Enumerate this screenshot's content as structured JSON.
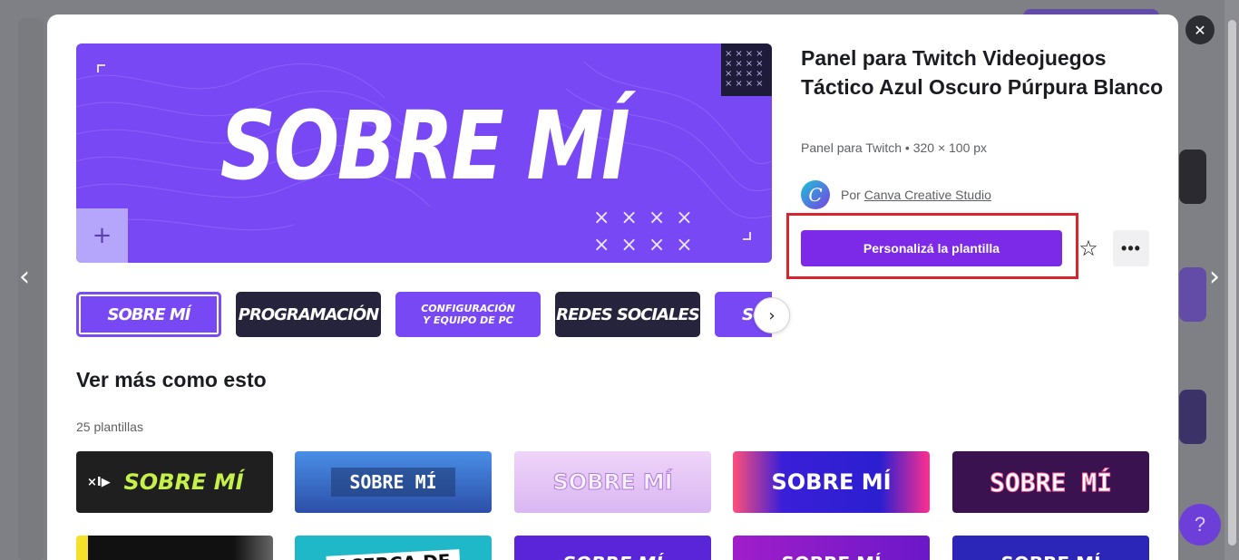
{
  "modal": {
    "title": "Panel para Twitch Videojuegos Táctico Azul Oscuro Púrpura Blanco",
    "subtitle": "Panel para Twitch • 320 × 100 px",
    "author_prefix": "Por",
    "author_name": "Canva Creative Studio",
    "author_logo_letter": "C",
    "cta_label": "Personalizá la plantilla",
    "star_icon": "☆",
    "more_icon": "•••",
    "close_icon": "✕",
    "prev_icon": "‹",
    "next_icon": "›",
    "thumb_next_icon": "›"
  },
  "preview": {
    "title": "SOBRE MÍ",
    "plus_icon": "+",
    "grid_marks": "××××\n××××\n××××\n××××",
    "x_marks": "××××\n××××",
    "bg_color": "#7848f4"
  },
  "thumbnails": [
    {
      "label": "SOBRE MÍ",
      "bg": "#7848f4",
      "selected": true
    },
    {
      "label": "PROGRAMACIÓN",
      "bg": "#26233d"
    },
    {
      "label": "CONFIGURACIÓN Y EQUIPO DE PC",
      "bg": "#7848f4"
    },
    {
      "label": "REDES SOCIALES",
      "bg": "#26233d"
    },
    {
      "label": "SO",
      "bg": "#7848f4"
    }
  ],
  "more_like_this": {
    "title": "Ver más como esto",
    "count": "25 plantillas",
    "cards": [
      {
        "label": "SOBRE MÍ",
        "bg": "#1f1f1f",
        "color": "#c6f04a",
        "brand": "×I▶"
      },
      {
        "label": "SOBRE MÍ",
        "bg": "#3b6fd6",
        "color": "#ffffff"
      },
      {
        "label": "SOBRE MÍ",
        "bg": "#e9c8f7",
        "color": "#f7f2ff"
      },
      {
        "label": "SOBRE MÍ",
        "bg": "#2b1fd0",
        "color": "#ffffff"
      },
      {
        "label": "SOBRE MÍ",
        "bg": "#3a124f",
        "color": "#ffffff"
      },
      {
        "label": "",
        "bg": "#111111",
        "color": "#f5e02a"
      },
      {
        "label": "ACERCA DE",
        "bg": "#1fb8c9",
        "color": "#111111"
      },
      {
        "label": "SOBRE MÍ",
        "bg": "#5a25d8",
        "color": "#ffffff"
      },
      {
        "label": "SOBRE MÍ",
        "bg": "#6a18c9",
        "color": "#ffffff"
      },
      {
        "label": "SOBRE MÍ",
        "bg": "#2c26b8",
        "color": "#ffffff"
      }
    ]
  },
  "colors": {
    "accent": "#7d2ae8",
    "highlight": "#d9232d"
  },
  "help_icon": "?"
}
